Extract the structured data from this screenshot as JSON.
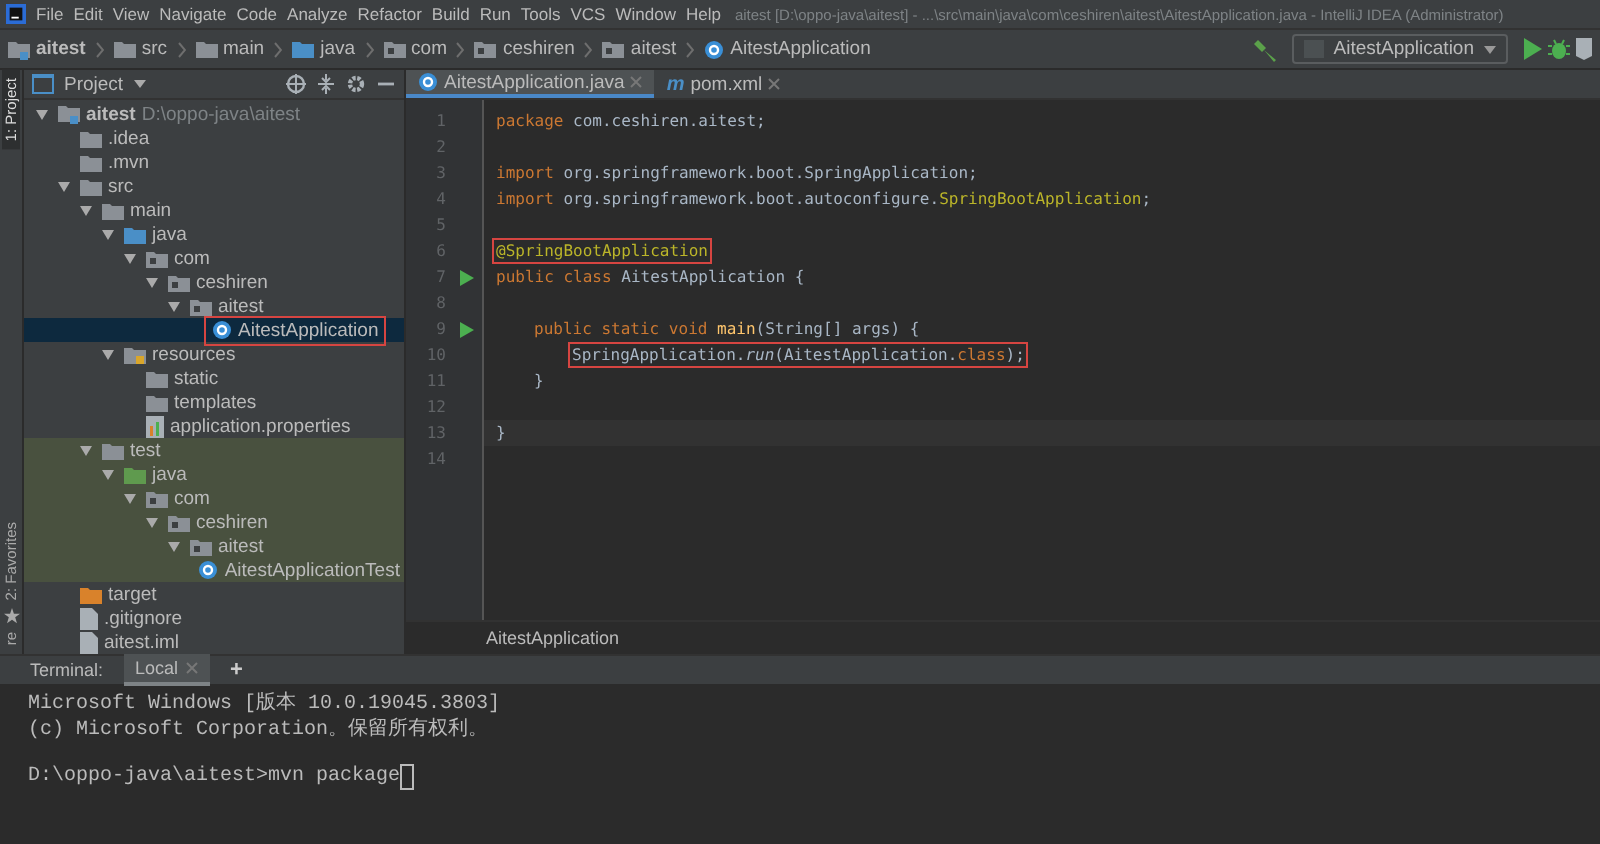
{
  "menu_bar": {
    "items": [
      "File",
      "Edit",
      "View",
      "Navigate",
      "Code",
      "Analyze",
      "Refactor",
      "Build",
      "Run",
      "Tools",
      "VCS",
      "Window",
      "Help"
    ],
    "title": "aitest [D:\\oppo-java\\aitest] - ...\\src\\main\\java\\com\\ceshiren\\aitest\\AitestApplication.java - IntelliJ IDEA (Administrator)"
  },
  "navigation_bar": {
    "breadcrumbs": [
      {
        "label": "aitest",
        "kind": "project"
      },
      {
        "label": "src",
        "kind": "folder"
      },
      {
        "label": "main",
        "kind": "folder"
      },
      {
        "label": "java",
        "kind": "source"
      },
      {
        "label": "com",
        "kind": "package"
      },
      {
        "label": "ceshiren",
        "kind": "package"
      },
      {
        "label": "aitest",
        "kind": "package"
      },
      {
        "label": "AitestApplication",
        "kind": "class"
      }
    ],
    "run_configuration": "AitestApplication"
  },
  "side_strip": {
    "top_tab": "1: Project",
    "bottom_tab": "2: Favorites",
    "bottom_tab_2": "re"
  },
  "project_panel": {
    "title": "Project",
    "tree": [
      {
        "label": "aitest",
        "path": "D:\\oppo-java\\aitest",
        "kind": "project",
        "expanded": true,
        "selected": false,
        "children": [
          {
            "label": ".idea",
            "kind": "folder",
            "expanded": false,
            "selected": false
          },
          {
            "label": ".mvn",
            "kind": "folder",
            "expanded": false,
            "selected": false
          },
          {
            "label": "src",
            "kind": "folder",
            "expanded": true,
            "selected": false,
            "children": [
              {
                "label": "main",
                "kind": "folder",
                "expanded": true,
                "selected": false,
                "children": [
                  {
                    "label": "java",
                    "kind": "source",
                    "expanded": true,
                    "selected": false,
                    "children": [
                      {
                        "label": "com",
                        "kind": "package",
                        "expanded": true,
                        "selected": false,
                        "children": [
                          {
                            "label": "ceshiren",
                            "kind": "package",
                            "expanded": true,
                            "selected": false,
                            "children": [
                              {
                                "label": "aitest",
                                "kind": "package",
                                "expanded": true,
                                "selected": false,
                                "children": [
                                  {
                                    "label": "AitestApplication",
                                    "kind": "class",
                                    "selected": true,
                                    "boxed": true
                                  }
                                ]
                              }
                            ]
                          }
                        ]
                      }
                    ]
                  },
                  {
                    "label": "resources",
                    "kind": "resources",
                    "expanded": true,
                    "selected": false,
                    "children": [
                      {
                        "label": "static",
                        "kind": "folder",
                        "selected": false
                      },
                      {
                        "label": "templates",
                        "kind": "folder",
                        "selected": false
                      },
                      {
                        "label": "application.properties",
                        "kind": "properties",
                        "selected": false
                      }
                    ]
                  }
                ]
              },
              {
                "label": "test",
                "kind": "folder",
                "expanded": true,
                "selected": false,
                "test": true,
                "children": [
                  {
                    "label": "java",
                    "kind": "test-source",
                    "expanded": true,
                    "selected": false,
                    "children": [
                      {
                        "label": "com",
                        "kind": "package",
                        "expanded": true,
                        "selected": false,
                        "children": [
                          {
                            "label": "ceshiren",
                            "kind": "package",
                            "expanded": true,
                            "selected": false,
                            "children": [
                              {
                                "label": "aitest",
                                "kind": "package",
                                "expanded": true,
                                "selected": false,
                                "children": [
                                  {
                                    "label": "AitestApplicationTest",
                                    "kind": "class",
                                    "selected": false
                                  }
                                ]
                              }
                            ]
                          }
                        ]
                      }
                    ]
                  }
                ]
              }
            ]
          },
          {
            "label": "target",
            "kind": "excluded",
            "expanded": false,
            "selected": false
          },
          {
            "label": ".gitignore",
            "kind": "file",
            "selected": false
          },
          {
            "label": "aitest.iml",
            "kind": "file",
            "selected": false
          }
        ]
      }
    ]
  },
  "editor": {
    "tabs": [
      {
        "label": "AitestApplication.java",
        "kind": "class",
        "selected": true
      },
      {
        "label": "pom.xml",
        "kind": "maven",
        "icon": "m",
        "selected": false
      }
    ],
    "lines": [
      {
        "number": "1",
        "tokens": [
          {
            "kind": "keyword",
            "text": "package "
          },
          {
            "kind": "plain",
            "text": "com.ceshiren.aitest;"
          }
        ]
      },
      {
        "number": "2"
      },
      {
        "number": "3",
        "tokens": [
          {
            "kind": "keyword",
            "text": "import "
          },
          {
            "kind": "plain",
            "text": "org.springframework.boot.SpringApplication;"
          }
        ]
      },
      {
        "number": "4",
        "tokens": [
          {
            "kind": "keyword",
            "text": "import "
          },
          {
            "kind": "plain",
            "text": "org.springframework.boot.autoconfigure."
          },
          {
            "kind": "annotation",
            "text": "SpringBootApplication"
          },
          {
            "kind": "plain",
            "text": ";"
          }
        ]
      },
      {
        "number": "5"
      },
      {
        "number": "6",
        "boxed": true,
        "tokens": [
          {
            "kind": "annotation",
            "text": "@SpringBootApplication"
          }
        ]
      },
      {
        "number": "7",
        "run": true,
        "tokens": [
          {
            "kind": "keyword",
            "text": "public class "
          },
          {
            "kind": "plain",
            "text": "AitestApplication {"
          }
        ]
      },
      {
        "number": "8"
      },
      {
        "number": "9",
        "run": true,
        "kind": "member",
        "tokens": [
          {
            "kind": "keyword",
            "text": "public static void "
          },
          {
            "kind": "method",
            "text": "main"
          },
          {
            "kind": "plain",
            "text": "(String[] args) {"
          }
        ]
      },
      {
        "number": "10",
        "boxed": true,
        "kind": "body",
        "tokens": [
          {
            "kind": "plain",
            "text": "SpringApplication."
          },
          {
            "kind": "static",
            "text": "run"
          },
          {
            "kind": "plain",
            "text": "(AitestApplication."
          },
          {
            "kind": "keyword",
            "text": "class"
          },
          {
            "kind": "plain",
            "text": ");"
          }
        ]
      },
      {
        "number": "11",
        "kind": "member",
        "tokens": [
          {
            "kind": "plain",
            "text": "}"
          }
        ]
      },
      {
        "number": "12"
      },
      {
        "number": "13",
        "current": true,
        "tokens": [
          {
            "kind": "plain",
            "text": "}"
          }
        ]
      },
      {
        "number": "14"
      }
    ],
    "breadcrumb": "AitestApplication"
  },
  "terminal": {
    "label": "Terminal:",
    "tabs": [
      {
        "label": "Local",
        "selected": true
      }
    ],
    "add": "+",
    "lines": [
      {
        "text": "Microsoft Windows [版本 10.0.19045.3803]"
      },
      {
        "text": "(c) Microsoft Corporation。保留所有权利。"
      },
      {
        "text": "D:\\oppo-java\\aitest>mvn package",
        "blank_before": true,
        "cursor": true
      }
    ]
  }
}
